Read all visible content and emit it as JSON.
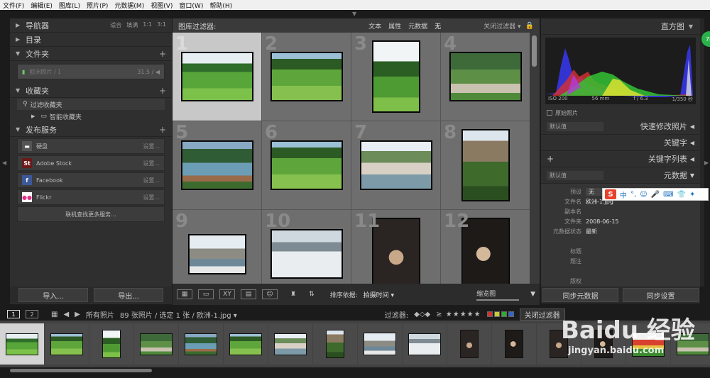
{
  "menu": [
    "文件(F)",
    "编辑(E)",
    "图库(L)",
    "照片(P)",
    "元数据(M)",
    "视图(V)",
    "窗口(W)",
    "帮助(H)"
  ],
  "left": {
    "navigator": "导航器",
    "nav_opts": [
      "适合",
      "填满",
      "1:1",
      "3:1"
    ],
    "catalog": "目录",
    "folders": "文件夹",
    "folder_row": {
      "name": "欧洲照片 / 1",
      "count": "31.5 / ◀"
    },
    "collections": "收藏夹",
    "collection_items": [
      "过滤收藏夹",
      "智能收藏夹"
    ],
    "publish": "发布服务",
    "services": [
      {
        "name": "硬盘",
        "setting": "设置...",
        "icon": "disk-icon"
      },
      {
        "name": "Adobe Stock",
        "setting": "设置...",
        "icon": "adobe-stock-icon"
      },
      {
        "name": "Facebook",
        "setting": "设置...",
        "icon": "facebook-icon"
      },
      {
        "name": "Flickr",
        "setting": "设置...",
        "icon": "flickr-icon"
      }
    ],
    "find_more": "联机查找更多服务...",
    "import": "导入...",
    "export": "导出..."
  },
  "filter": {
    "label": "图库过滤器:",
    "options": [
      "文本",
      "属性",
      "元数据",
      "无"
    ],
    "off": "关闭过滤器"
  },
  "grid_cells": [
    {
      "num": "1",
      "scene": "hills",
      "sel": true
    },
    {
      "num": "2",
      "scene": "village"
    },
    {
      "num": "3",
      "scene": "portrait-hills"
    },
    {
      "num": "4",
      "scene": "town"
    },
    {
      "num": "5",
      "scene": "lake"
    },
    {
      "num": "6",
      "scene": "village"
    },
    {
      "num": "7",
      "scene": "church"
    },
    {
      "num": "8",
      "scene": "castle"
    },
    {
      "num": "9",
      "scene": "cathedral"
    },
    {
      "num": "10",
      "scene": "snow"
    },
    {
      "num": "11",
      "scene": "dancer"
    },
    {
      "num": "12",
      "scene": "dancer2"
    }
  ],
  "toolbar": {
    "sort_label": "排序依据:",
    "sort_value": "拍摄时间 ▾",
    "thumb_label": "缩览图"
  },
  "right": {
    "histogram": "直方图",
    "hist_info": [
      "ISO 200",
      "56 mm",
      "f / 6.3",
      "1/350 秒"
    ],
    "original": "原始照片",
    "default_value": "默认值",
    "quick_develop": "快速修改照片",
    "keywords": "关键字",
    "keyword_list": "关键字列表",
    "metadata": "元数据",
    "preset_label": "预设",
    "preset_value": "无",
    "meta_fields": [
      {
        "k": "文件名",
        "v": "欧洲-1.jpg"
      },
      {
        "k": "副本名",
        "v": ""
      },
      {
        "k": "文件夹",
        "v": "2008-06-15"
      },
      {
        "k": "元数据状态",
        "v": "最新"
      },
      {
        "k": "",
        "v": ""
      },
      {
        "k": "标题",
        "v": ""
      },
      {
        "k": "题注",
        "v": ""
      },
      {
        "k": "",
        "v": ""
      },
      {
        "k": "版权",
        "v": ""
      }
    ],
    "sync_meta": "同步元数据",
    "sync_settings": "同步设置"
  },
  "ime": {
    "logo": "S",
    "text": "中"
  },
  "badge": "78",
  "filmbar": {
    "pages": [
      "1",
      "2"
    ],
    "source": "所有照片",
    "count": "89 张照片 / 选定 1 张 / 欧洲-1.jpg ▾",
    "filter_label": "过滤器:",
    "stars": "≥ ★★★★★",
    "filter_off": "关闭过滤器"
  },
  "film_scenes": [
    "hills",
    "village",
    "portrait-hills",
    "town",
    "lake",
    "village",
    "church",
    "castle",
    "cathedral",
    "snow",
    "dancer",
    "dancer2",
    "dancer",
    "dancer2",
    "flowers",
    "town",
    "lake"
  ],
  "watermark": {
    "big": "Baidu 经验",
    "small": "jingyan.baidu.com"
  }
}
